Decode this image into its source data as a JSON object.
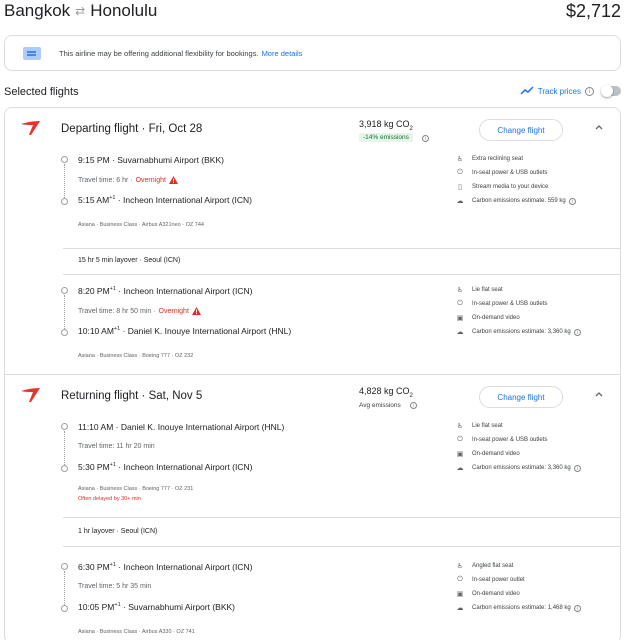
{
  "header": {
    "origin": "Bangkok",
    "destination": "Honolulu",
    "price": "$2,712"
  },
  "notice": {
    "text": "This airline may be offering additional flexibility for bookings.",
    "link": "More details"
  },
  "selected": {
    "title": "Selected flights",
    "track_label": "Track prices",
    "track_on": false
  },
  "departing": {
    "title": "Departing flight · Fri, Oct 28",
    "co2": "3,918 kg CO",
    "co2_sub": "2",
    "badge": "-14% emissions",
    "change": "Change flight",
    "legs": [
      {
        "dep_time": "9:15 PM",
        "dep_airport": " · Suvarnabhumi Airport (BKK)",
        "travel": "Travel time: 6 hr · ",
        "overnight": "Overnight",
        "arr_time": "5:15 AM",
        "arr_sup": "+1",
        "arr_airport": " · Incheon International Airport (ICN)",
        "meta": "Asiana · Business Class · Airbus A321neo · OZ 744",
        "amenities": [
          "Extra reclining seat",
          "In-seat power & USB outlets",
          "Stream media to your device",
          "Carbon emissions estimate: 559 kg"
        ]
      },
      {
        "dep_time": "8:20 PM",
        "dep_sup": "+1",
        "dep_airport": " · Incheon International Airport (ICN)",
        "travel": "Travel time: 8 hr 50 min · ",
        "overnight": "Overnight",
        "arr_time": "10:10 AM",
        "arr_sup": "+1",
        "arr_airport": " · Daniel K. Inouye International Airport (HNL)",
        "meta": "Asiana · Business Class · Boeing 777 · OZ 232",
        "amenities": [
          "Lie flat seat",
          "In-seat power & USB outlets",
          "On-demand video",
          "Carbon emissions estimate: 3,360 kg"
        ]
      }
    ],
    "layover": "15 hr 5 min layover · Seoul (ICN)"
  },
  "returning": {
    "title": "Returning flight · Sat, Nov 5",
    "co2": "4,828 kg CO",
    "co2_sub": "2",
    "avg": "Avg emissions",
    "change": "Change flight",
    "legs": [
      {
        "dep_time": "11:10 AM",
        "dep_airport": " · Daniel K. Inouye International Airport (HNL)",
        "travel": "Travel time: 11 hr 20 min",
        "arr_time": "5:30 PM",
        "arr_sup": "+1",
        "arr_airport": " · Incheon International Airport (ICN)",
        "meta": "Asiana · Business Class · Boeing 777 · OZ 231",
        "delay": "Often delayed by 30+ min",
        "amenities": [
          "Lie flat seat",
          "In-seat power & USB outlets",
          "On-demand video",
          "Carbon emissions estimate: 3,360 kg"
        ]
      },
      {
        "dep_time": "6:30 PM",
        "dep_sup": "+1",
        "dep_airport": " · Incheon International Airport (ICN)",
        "travel": "Travel time: 5 hr 35 min",
        "arr_time": "10:05 PM",
        "arr_sup": "+1",
        "arr_airport": " · Suvarnabhumi Airport (BKK)",
        "meta": "Asiana · Business Class · Airbus A330 · OZ 741",
        "amenities": [
          "Angled flat seat",
          "In-seat power outlet",
          "On-demand video",
          "Carbon emissions estimate: 1,468 kg"
        ]
      }
    ],
    "layover": "1 hr layover · Seoul (ICN)"
  },
  "colors": {
    "link": "#1a73e8",
    "warning": "#d93025",
    "brand": "#e8322a"
  }
}
